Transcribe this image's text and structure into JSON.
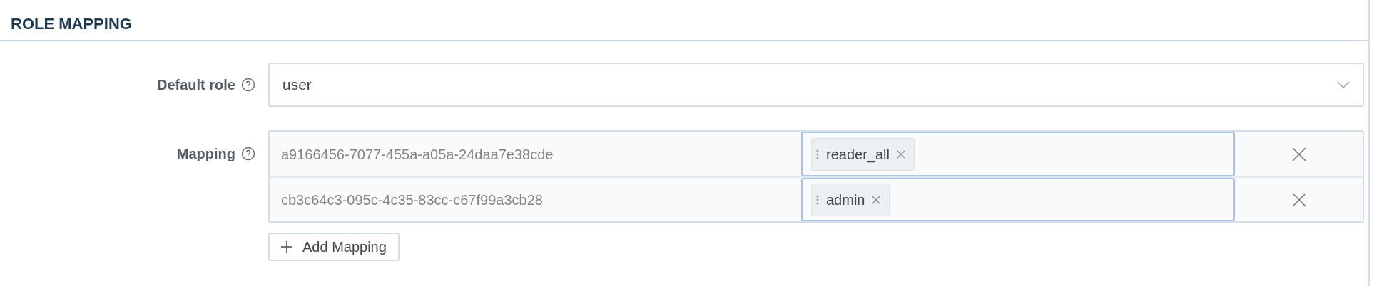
{
  "section": {
    "title": "ROLE MAPPING"
  },
  "default_role": {
    "label": "Default role",
    "value": "user"
  },
  "mapping": {
    "label": "Mapping",
    "rows": [
      {
        "key": "a9166456-7077-455a-a05a-24daa7e38cde",
        "roles": [
          "reader_all"
        ]
      },
      {
        "key": "cb3c64c3-095c-4c35-83cc-c67f99a3cb28",
        "roles": [
          "admin"
        ]
      }
    ]
  },
  "add_button": {
    "label": "Add Mapping"
  }
}
